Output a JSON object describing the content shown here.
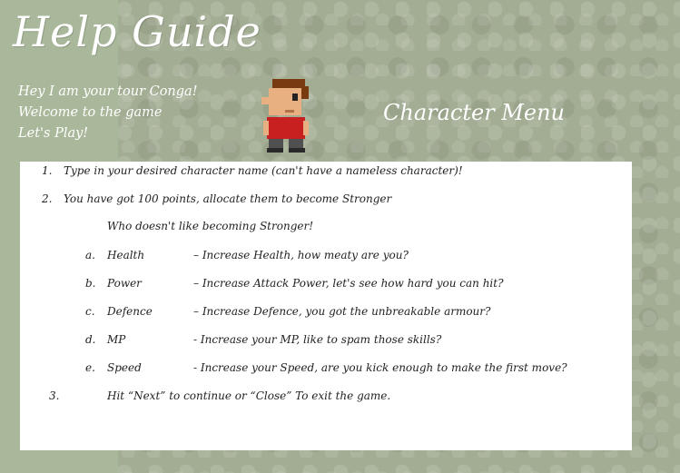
{
  "title": "Help Guide",
  "intro_lines": [
    "Hey I am your tour Conga!",
    "Welcome to the game",
    "Let's Play!"
  ],
  "section_title": "Character Menu",
  "steps": [
    {
      "num": "1.",
      "text": "Type in your desired character name (can't have a nameless character)!"
    },
    {
      "num": "2.",
      "text": "You have got 100 points, allocate them to become Stronger"
    }
  ],
  "subtitle": "Who doesn't like becoming Stronger!",
  "stats": [
    {
      "letter": "a.",
      "name": "Health",
      "desc": "– Increase Health, how meaty are you?"
    },
    {
      "letter": "b.",
      "name": "Power",
      "desc": "– Increase Attack Power, let's see how hard you can hit?"
    },
    {
      "letter": "c.",
      "name": "Defence",
      "desc": "– Increase Defence, you got the unbreakable armour?"
    },
    {
      "letter": "d.",
      "name": "MP",
      "desc": "- Increase your MP, like to spam those skills?"
    },
    {
      "letter": "e.",
      "name": "Speed",
      "desc": "- Increase your Speed, are you kick enough to make the first move?"
    }
  ],
  "step3": {
    "num": "3.",
    "text": "Hit “Next” to continue or “Close” To exit the game."
  },
  "character": {
    "skin": "#e8b080",
    "hair": "#7a3a10",
    "shirt": "#c82020",
    "pants": "#505050"
  }
}
